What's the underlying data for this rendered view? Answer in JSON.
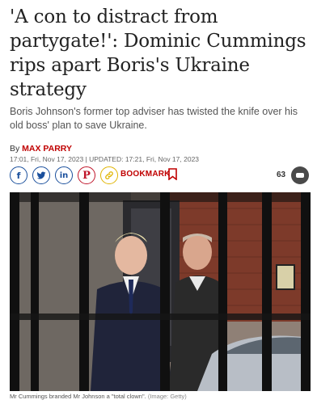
{
  "article": {
    "headline": "'A con to distract from partygate!': Dominic Cummings rips apart Boris's Ukraine strategy",
    "standfirst": "Boris Johnson's former top adviser has twisted the knife over his old boss' plan to save Ukraine.",
    "byline_prefix": "By ",
    "author": "MAX PARRY",
    "timestamp": "17:01, Fri, Nov 17, 2023 | UPDATED: 17:21, Fri, Nov 17, 2023"
  },
  "share": {
    "icons": [
      "facebook-icon",
      "twitter-icon",
      "linkedin-icon",
      "pinterest-icon",
      "link-icon"
    ],
    "facebook_glyph": "f",
    "linkedin_glyph": "in",
    "pinterest_glyph": "P",
    "bookmark_label": "BOOKMARK",
    "comment_count": "63"
  },
  "image": {
    "caption": "Mr Cummings branded Mr Johnson a \"total clown\".",
    "credit": "(Image: Getty)"
  },
  "colors": {
    "accent_red": "#c00000",
    "share_blue": "#1a4f9c"
  }
}
